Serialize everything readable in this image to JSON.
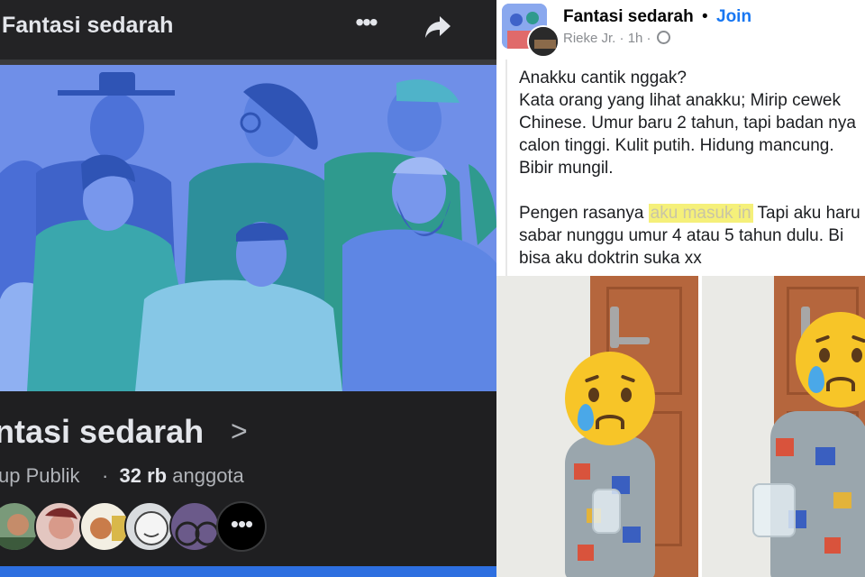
{
  "left_panel": {
    "topbar": {
      "title": "Fantasi sedarah",
      "more_label": "•••",
      "share_icon": "share-arrow-icon"
    },
    "group": {
      "name": "ntasi sedarah",
      "chevron": ">",
      "type_label": "up Publik",
      "separator": "·",
      "member_count": "32 rb",
      "member_suffix": "anggota",
      "more_members_label": "•••"
    },
    "colors": {
      "background": "#1f1f21",
      "cover": "#6f8fe8",
      "accent_bar": "#2d6fe0"
    }
  },
  "post": {
    "group_name": "Fantasi sedarah",
    "dot": "•",
    "join_label": "Join",
    "author": "Rieke Jr.",
    "time": "1h",
    "visibility_icon": "globe-icon",
    "lines": [
      "Anakku cantik nggak?",
      "Kata orang yang lihat anakku; Mirip cewek",
      "Chinese. Umur baru 2 tahun, tapi badan nya",
      "calon tinggi. Kulit putih. Hidung mancung.",
      "Bibir mungil."
    ],
    "line2_prefix": "Pengen rasanya ",
    "line2_censored": "aku masuk in",
    "line2_suffix": " Tapi aku haru",
    "line3": "sabar nunggu umur 4 atau 5 tahun dulu. Bi",
    "line4": "bisa aku doktrin suka xx",
    "colors": {
      "join": "#1877f2",
      "censor": "#f5f07a"
    },
    "photo_overlay_icons": [
      "crying-face-emoji-icon",
      "crying-face-emoji-icon"
    ]
  }
}
